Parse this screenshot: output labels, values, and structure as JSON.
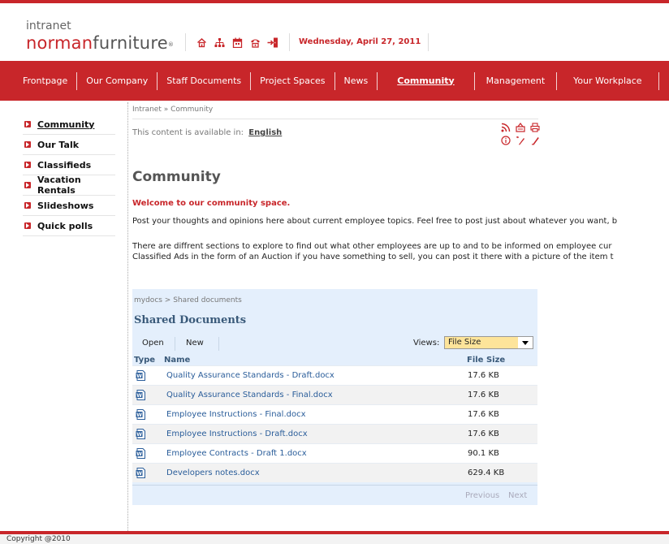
{
  "brand": {
    "small": "intranet",
    "part1": "norman",
    "part2": "furniture",
    "mark": "®"
  },
  "header": {
    "date": "Wednesday, April 27, 2011",
    "icons": [
      "home-icon",
      "sitemap-icon",
      "calendar-icon",
      "phone-icon",
      "logout-icon"
    ]
  },
  "nav": {
    "items": [
      {
        "label": "Frontpage"
      },
      {
        "label": "Our Company"
      },
      {
        "label": "Staff Documents"
      },
      {
        "label": "Project Spaces"
      },
      {
        "label": "News"
      },
      {
        "label": "Community",
        "active": true
      },
      {
        "label": "Management"
      },
      {
        "label": "Your Workplace"
      }
    ]
  },
  "sidebar": {
    "items": [
      {
        "label": "Community",
        "active": true
      },
      {
        "label": "Our Talk"
      },
      {
        "label": "Classifieds"
      },
      {
        "label": "Vacation Rentals"
      },
      {
        "label": "Slideshows"
      },
      {
        "label": "Quick polls"
      }
    ]
  },
  "content": {
    "breadcrumb": "Intranet » Community",
    "available_text": "This content is available in:",
    "available_lang": "English",
    "title": "Community",
    "welcome": "Welcome to our community space.",
    "para1": "Post your thoughts and opinions here about current employee topics. Feel free to post just about whatever you want, b",
    "para2_line1": "There are diffrent sections to explore to find out what other employees are up to and to be informed on employee cur",
    "para2_line2": "Classified Ads in the form of an Auction if you have something to sell, you can post it there with a picture of the item t"
  },
  "docs": {
    "breadcrumb": "mydocs > Shared documents",
    "title": "Shared Documents",
    "toolbar": {
      "open": "Open",
      "new": "New",
      "views_label": "Views:",
      "views_value": "File Size"
    },
    "columns": {
      "type": "Type",
      "name": "Name",
      "size": "File Size"
    },
    "files": [
      {
        "name": "Quality Assurance Standards - Draft.docx",
        "size": "17.6 KB"
      },
      {
        "name": "Quality Assurance Standards - Final.docx",
        "size": "17.6 KB"
      },
      {
        "name": "Employee Instructions - Final.docx",
        "size": "17.6 KB"
      },
      {
        "name": "Employee Instructions - Draft.docx",
        "size": "17.6 KB"
      },
      {
        "name": "Employee Contracts - Draft 1.docx",
        "size": "90.1 KB"
      },
      {
        "name": "Developers notes.docx",
        "size": "629.4 KB"
      }
    ],
    "pager": {
      "previous": "Previous",
      "next": "Next"
    }
  },
  "footer": {
    "copyright": "Copyright @2010"
  },
  "colors": {
    "brand_red": "#c8262a",
    "panel_blue": "#e4effc",
    "link_blue": "#2a5d9a"
  }
}
